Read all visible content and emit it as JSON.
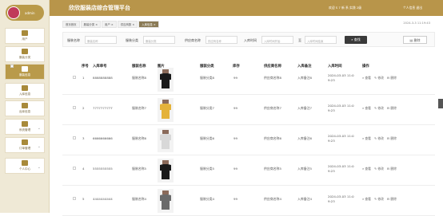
{
  "header": {
    "title": "欣欣服装店综合管理平台",
    "right1": "欢迎 S 7 新 系 实践 2级",
    "right2": "个人信息 退出"
  },
  "sidebar": {
    "user": "admin",
    "items": [
      {
        "label": "用户"
      },
      {
        "label": "服装分类"
      },
      {
        "label": "服装信息"
      },
      {
        "label": "入库信息"
      },
      {
        "label": "出库信息"
      },
      {
        "label": "系统管理"
      },
      {
        "label": "订单管理"
      },
      {
        "label": "个人中心"
      }
    ]
  },
  "breadcrumb": {
    "items": [
      "首页首页",
      "服装分类 ×",
      "用户 ×",
      "供应商数 ×",
      "入库信息 ×"
    ],
    "time": "2024-3-3 11:19:43"
  },
  "filter": {
    "name_label": "服装名称",
    "name_ph": "服装名称",
    "cat_label": "服装分类",
    "cat_ph": "服装分类",
    "sup_label": "供应商名称",
    "sup_ph": "供应商名称",
    "time_label": "入库时间",
    "start_ph": "入库时间开始",
    "sep": "至",
    "end_ph": "入库时间结束",
    "search": "查找",
    "delete": "删除"
  },
  "columns": [
    "序号",
    "入库单号",
    "服装名称",
    "图片",
    "服装分类",
    "库存",
    "供应商名称",
    "入库备注",
    "入库时间",
    "操作"
  ],
  "rows": [
    {
      "no": "1",
      "code": "8888888888",
      "name": "服装名称8",
      "cat": "服装分类8",
      "stock": "99",
      "sup": "供应商名称8",
      "remark": "入库备注8",
      "time": "2024-03-03 11:0 9:23"
    },
    {
      "no": "2",
      "code": "7777777777",
      "name": "服装名称7",
      "cat": "服装分类7",
      "stock": "99",
      "sup": "供应商名称7",
      "remark": "入库备注7",
      "time": "2024-03-03 11:0 9:23"
    },
    {
      "no": "3",
      "code": "6666666666",
      "name": "服装名称6",
      "cat": "服装分类6",
      "stock": "99",
      "sup": "供应商名称6",
      "remark": "入库备注6",
      "time": "2024-03-03 11:0 9:23"
    },
    {
      "no": "4",
      "code": "5555555555",
      "name": "服装名称5",
      "cat": "服装分类5",
      "stock": "99",
      "sup": "供应商名称5",
      "remark": "入库备注5",
      "time": "2024-03-03 11:0 9:23"
    },
    {
      "no": "5",
      "code": "4444444444",
      "name": "服装名称4",
      "cat": "服装分类4",
      "stock": "99",
      "sup": "供应商名称4",
      "remark": "入库备注4",
      "time": "2024-03-03 11:0 9:23"
    }
  ],
  "ops": {
    "view": "查看",
    "edit": "修改",
    "del": "删除"
  },
  "colors": {
    "accent": "#b8954a",
    "sidebar": "#efe9d6"
  }
}
